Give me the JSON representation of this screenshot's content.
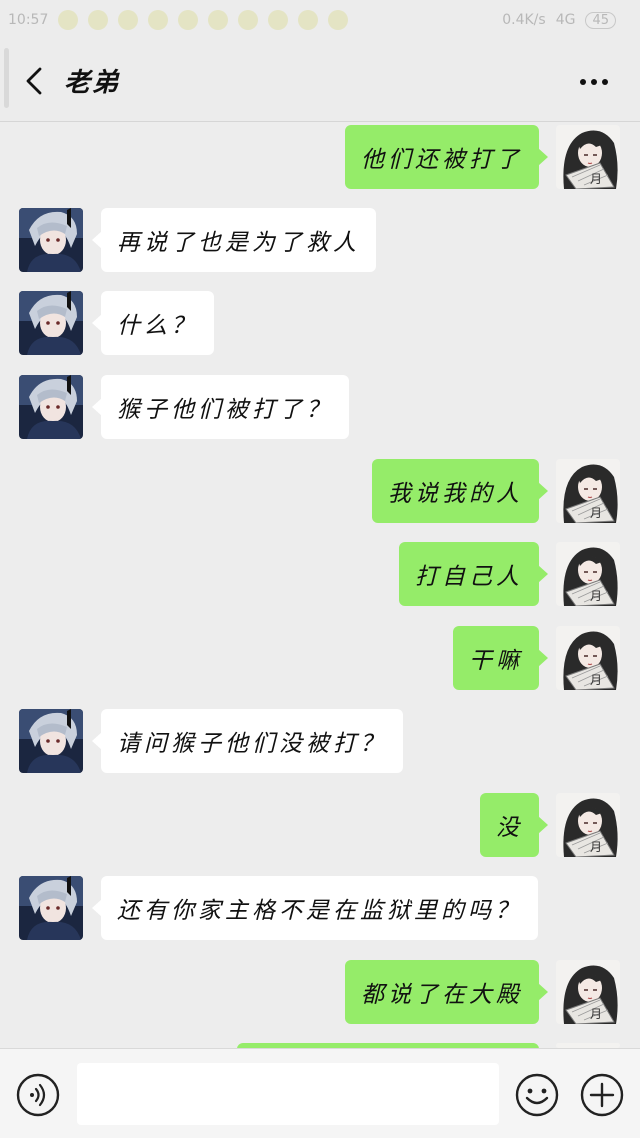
{
  "status_bar": {
    "time": "10:57",
    "network_speed": "0.4K/s",
    "signal": "4G",
    "battery": "45"
  },
  "header": {
    "title": "老弟"
  },
  "messages": [
    {
      "side": "right",
      "text": "他们还被打了"
    },
    {
      "side": "left",
      "text": "再说了也是为了救人"
    },
    {
      "side": "left",
      "text": "什么？"
    },
    {
      "side": "left",
      "text": "猴子他们被打了？"
    },
    {
      "side": "right",
      "text": "我说我的人"
    },
    {
      "side": "right",
      "text": "打自己人"
    },
    {
      "side": "right",
      "text": "干嘛"
    },
    {
      "side": "left",
      "text": "请问猴子他们没被打？"
    },
    {
      "side": "right",
      "text": "没"
    },
    {
      "side": "left",
      "text": "还有你家主格不是在监狱里的吗？"
    },
    {
      "side": "right",
      "text": "都说了在大殿"
    },
    {
      "side": "right",
      "text": ""
    }
  ],
  "input": {
    "placeholder": ""
  },
  "colors": {
    "sent_bubble": "#95ec69",
    "received_bubble": "#ffffff",
    "background": "#ededed"
  }
}
